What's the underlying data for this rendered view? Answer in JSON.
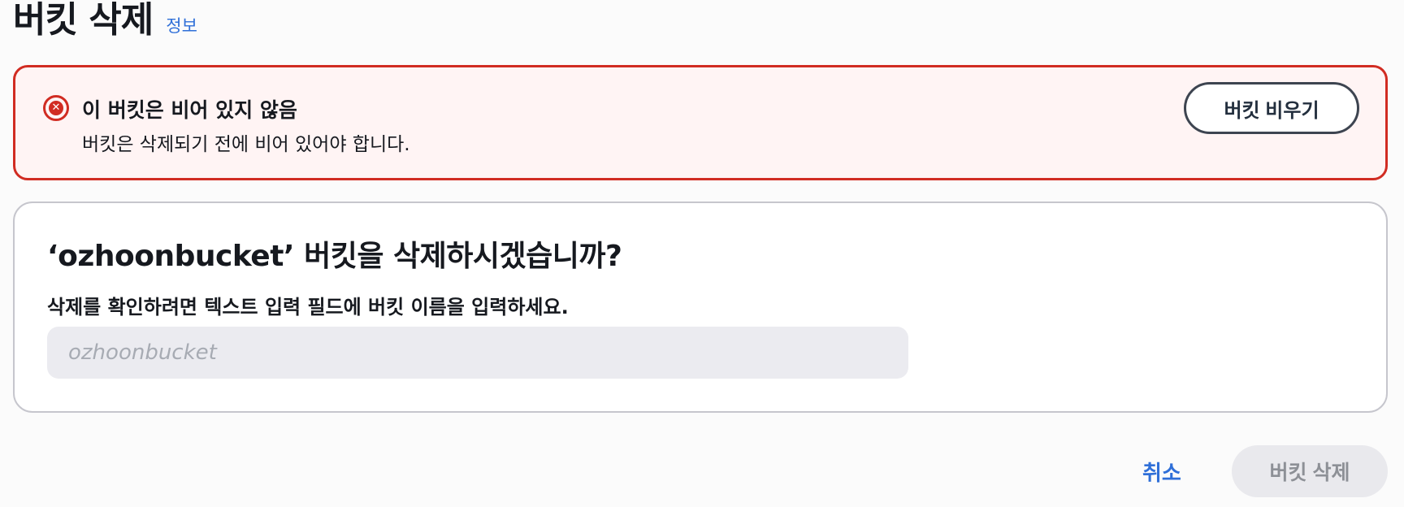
{
  "header": {
    "title": "버킷 삭제",
    "info_link": "정보"
  },
  "alert": {
    "type": "error",
    "icon": "error-circle-icon",
    "title": "이 버킷은 비어 있지 않음",
    "body": "버킷은 삭제되기 전에 비어 있어야 합니다.",
    "action_label": "버킷 비우기"
  },
  "confirm": {
    "title": "‘ozhoonbucket’ 버킷을 삭제하시겠습니까?",
    "label": "삭제를 확인하려면 텍스트 입력 필드에 버킷 이름을 입력하세요.",
    "input_value": "",
    "input_placeholder": "ozhoonbucket"
  },
  "footer": {
    "cancel_label": "취소",
    "delete_label": "버킷 삭제",
    "delete_disabled": true
  },
  "colors": {
    "error": "#d12c22",
    "link": "#2f6fd8",
    "text": "#16191f"
  }
}
